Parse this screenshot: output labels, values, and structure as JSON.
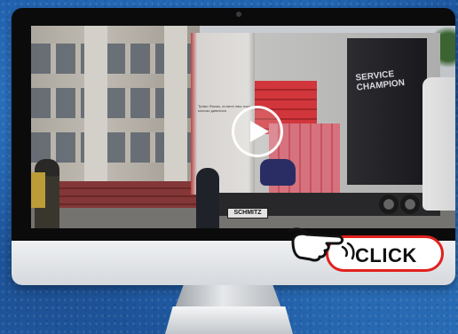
{
  "video": {
    "truck_side_text": "SERVICE CHAMPION",
    "plate_text": "SCHMITZ",
    "door_note": "Тримо Фоком, останні лиш тиру молоко дивитися"
  },
  "cta": {
    "click_label": "CLICK"
  },
  "colors": {
    "background": "#1d5aa8",
    "cta_border": "#e0211f",
    "bezel": "#0b0b0c"
  },
  "icons": [
    "play-icon",
    "hand-pointer-icon",
    "click-sparkle-icon"
  ]
}
